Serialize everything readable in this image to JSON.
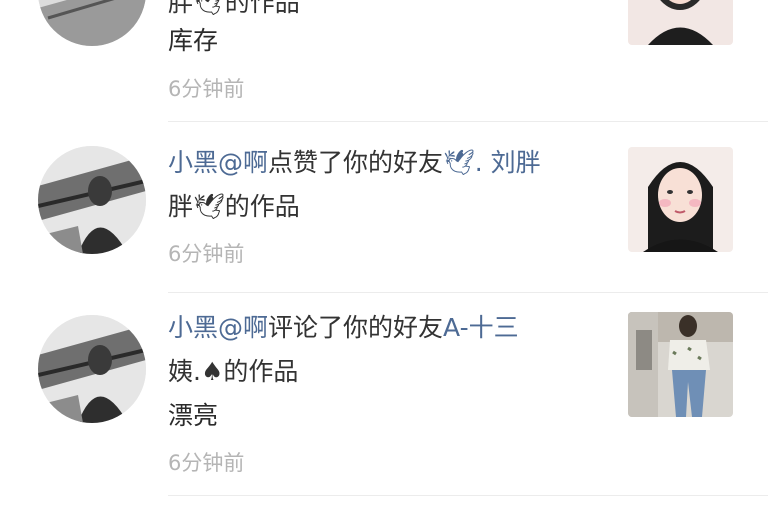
{
  "notifications": [
    {
      "line2": "胖🕊的作品",
      "comment": "库存",
      "time": "6分钟前"
    },
    {
      "name": "小黑@啊",
      "action": "点赞了你的好友",
      "friend": "🕊. 刘胖",
      "line2": "胖🕊的作品",
      "time": "6分钟前"
    },
    {
      "name": "小黑@啊",
      "action": "评论了你的好友",
      "friend": "A-十三",
      "line2": "姨.♠的作品",
      "comment": "漂亮",
      "time": "6分钟前"
    }
  ],
  "colors": {
    "name": "#4d6a94",
    "text": "#333333",
    "time": "#b5b5b5",
    "divider": "#ececec"
  }
}
